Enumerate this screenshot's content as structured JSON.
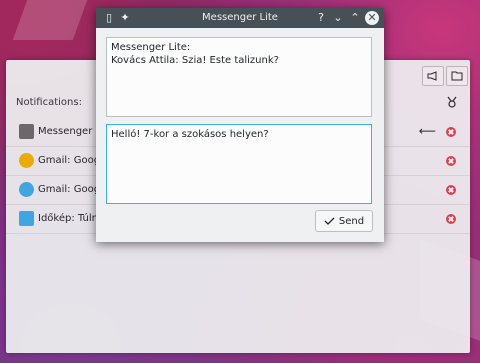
{
  "background": {
    "panel": {
      "notifications_label": "Notifications:",
      "rows": [
        {
          "app": "Messenger Lite",
          "color": "#6b6b6b"
        },
        {
          "app": "Gmail: Google",
          "color": "#f4b400"
        },
        {
          "app": "Gmail: Google",
          "color": "#3daee9"
        },
        {
          "app": "Időkép: Túlny",
          "color": "#3daee9"
        }
      ]
    }
  },
  "dialog": {
    "title": "Messenger Lite",
    "help": "?",
    "minimize": "⌄",
    "maximize": "⌃",
    "close": "✕",
    "history": {
      "line1": "Messenger Lite:",
      "line2": "Kovács Attila: Szia! Este talizunk?"
    },
    "compose": {
      "text": "Helló! 7-kor a szokásos helyen?"
    },
    "send_label": "Send",
    "accent": "#3daee9"
  }
}
